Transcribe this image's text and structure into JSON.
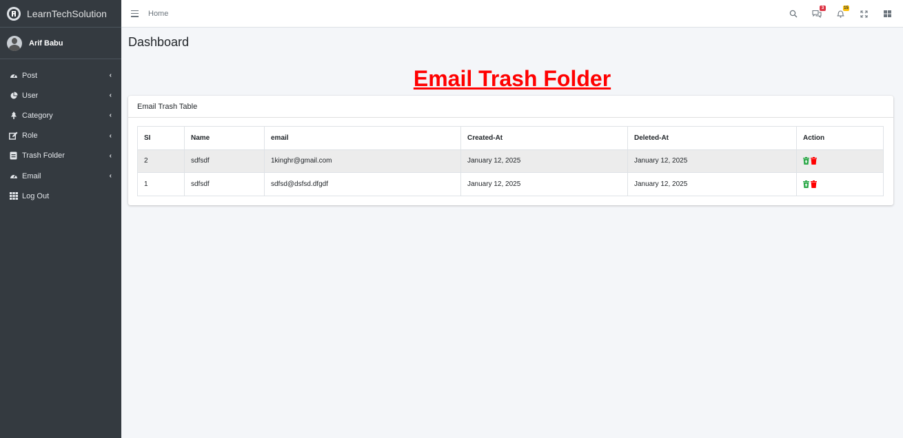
{
  "brand": {
    "name": "LearnTechSolution"
  },
  "user": {
    "name": "Arif Babu"
  },
  "sidebar": {
    "items": [
      {
        "label": "Post",
        "icon": "tachometer-icon",
        "has_arrow": true
      },
      {
        "label": "User",
        "icon": "pie-chart-icon",
        "has_arrow": true
      },
      {
        "label": "Category",
        "icon": "tree-icon",
        "has_arrow": true
      },
      {
        "label": "Role",
        "icon": "edit-icon",
        "has_arrow": true
      },
      {
        "label": "Trash Folder",
        "icon": "trash-folder-icon",
        "has_arrow": true
      },
      {
        "label": "Email",
        "icon": "tachometer-icon",
        "has_arrow": true
      },
      {
        "label": "Log Out",
        "icon": "grid-icon",
        "has_arrow": false
      }
    ],
    "arrow_glyph": "‹"
  },
  "topbar": {
    "home_label": "Home",
    "messages_badge": "3",
    "notifications_badge": "15"
  },
  "page": {
    "title": "Dashboard",
    "heading": "Email Trash Folder"
  },
  "card": {
    "title": "Email Trash Table",
    "columns": [
      "SI",
      "Name",
      "email",
      "Created-At",
      "Deleted-At",
      "Action"
    ],
    "rows": [
      {
        "si": "2",
        "name": "sdfsdf",
        "email": "1kinghr@gmail.com",
        "created_at": "January 12, 2025",
        "deleted_at": "January 12, 2025"
      },
      {
        "si": "1",
        "name": "sdfsdf",
        "email": "sdfsd@dsfsd.dfgdf",
        "created_at": "January 12, 2025",
        "deleted_at": "January 12, 2025"
      }
    ]
  },
  "colors": {
    "sidebar_bg": "#343a40",
    "heading_red": "#ff0000",
    "restore_green": "#28a745",
    "delete_red": "#ff0000",
    "badge_red": "#dc3545",
    "badge_yellow": "#ffc107"
  }
}
